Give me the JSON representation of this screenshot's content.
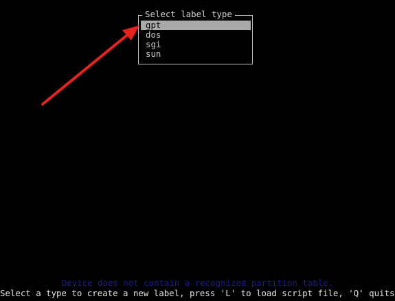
{
  "dialog": {
    "title": "Select label type",
    "options": [
      {
        "label": "gpt",
        "selected": true
      },
      {
        "label": "dos",
        "selected": false
      },
      {
        "label": "sgi",
        "selected": false
      },
      {
        "label": "sun",
        "selected": false
      }
    ]
  },
  "status": {
    "message": "Device does not contain a recognized partition table."
  },
  "hint": {
    "message": "Select a type to create a new label, press 'L' to load script file, 'Q' quits."
  },
  "colors": {
    "background": "#000000",
    "selection_bg": "#a9a9a9",
    "status_text": "#1d1d86",
    "annotation_arrow": "#e8231f"
  }
}
